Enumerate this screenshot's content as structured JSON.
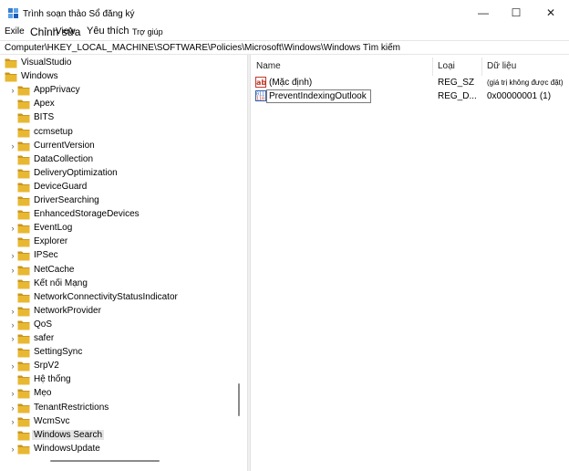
{
  "window": {
    "title": "Trình soạn thảo Sổ đăng ký"
  },
  "window_controls": {
    "minimize": "—",
    "maximize": "☐",
    "close": "✕"
  },
  "menu": [
    "Exile",
    "Chỉnh sửa",
    "View",
    "Yêu thích",
    "Trợ giúp"
  ],
  "address": "Computer\\HKEY_LOCAL_MACHINE\\SOFTWARE\\Policies\\Microsoft\\Windows\\Windows Tìm kiếm",
  "tree": [
    {
      "label": "VisualStudio",
      "expandable": false,
      "level": 0
    },
    {
      "label": "Windows",
      "expandable": false,
      "level": 0
    },
    {
      "label": "AppPrivacy",
      "expandable": true,
      "level": 1
    },
    {
      "label": "Apex",
      "expandable": false,
      "level": 1
    },
    {
      "label": "BITS",
      "expandable": false,
      "level": 1
    },
    {
      "label": "ccmsetup",
      "expandable": false,
      "level": 1
    },
    {
      "label": "CurrentVersion",
      "expandable": true,
      "level": 1
    },
    {
      "label": "DataCollection",
      "expandable": false,
      "level": 1
    },
    {
      "label": "DeliveryOptimization",
      "expandable": false,
      "level": 1
    },
    {
      "label": "DeviceGuard",
      "expandable": false,
      "level": 1
    },
    {
      "label": "DriverSearching",
      "expandable": false,
      "level": 1
    },
    {
      "label": "EnhancedStorageDevices",
      "expandable": false,
      "level": 1
    },
    {
      "label": "EventLog",
      "expandable": true,
      "level": 1
    },
    {
      "label": "Explorer",
      "expandable": false,
      "level": 1
    },
    {
      "label": "IPSec",
      "expandable": true,
      "level": 1
    },
    {
      "label": "NetCache",
      "expandable": true,
      "level": 1
    },
    {
      "label": "Kết nối Mạng",
      "expandable": false,
      "level": 1
    },
    {
      "label": "NetworkConnectivityStatusIndicator",
      "expandable": false,
      "level": 1
    },
    {
      "label": "NetworkProvider",
      "expandable": true,
      "level": 1
    },
    {
      "label": "QoS",
      "expandable": true,
      "level": 1
    },
    {
      "label": "safer",
      "expandable": true,
      "level": 1
    },
    {
      "label": "SettingSync",
      "expandable": false,
      "level": 1
    },
    {
      "label": "SrpV2",
      "expandable": true,
      "level": 1
    },
    {
      "label": "Hệ thống",
      "expandable": false,
      "level": 1
    },
    {
      "label": "Mẹo",
      "expandable": true,
      "level": 1
    },
    {
      "label": "TenantRestrictions",
      "expandable": true,
      "level": 1
    },
    {
      "label": "WcmSvc",
      "expandable": true,
      "level": 1
    },
    {
      "label": "Windows Search",
      "expandable": false,
      "level": 1,
      "selected": true
    },
    {
      "label": "WindowsUpdate",
      "expandable": true,
      "level": 1
    }
  ],
  "columns": {
    "name": "Name",
    "type": "Loại",
    "data": "Dữ liệu"
  },
  "values": [
    {
      "icon": "string-value-icon",
      "name": "(Mặc định)",
      "type": "REG_SZ",
      "data": "(giá trị không được đặt)"
    },
    {
      "icon": "dword-value-icon",
      "name": "PreventIndexingOutlook",
      "type": "REG_D...",
      "data": "0x00000001 (1)",
      "editing": true
    }
  ],
  "colors": {
    "folder": "#e8b833",
    "folder_dark": "#c9951f",
    "selection": "#e5e5e5",
    "string_icon": "#c0392b",
    "dword_icon": "#2f5fb3"
  }
}
